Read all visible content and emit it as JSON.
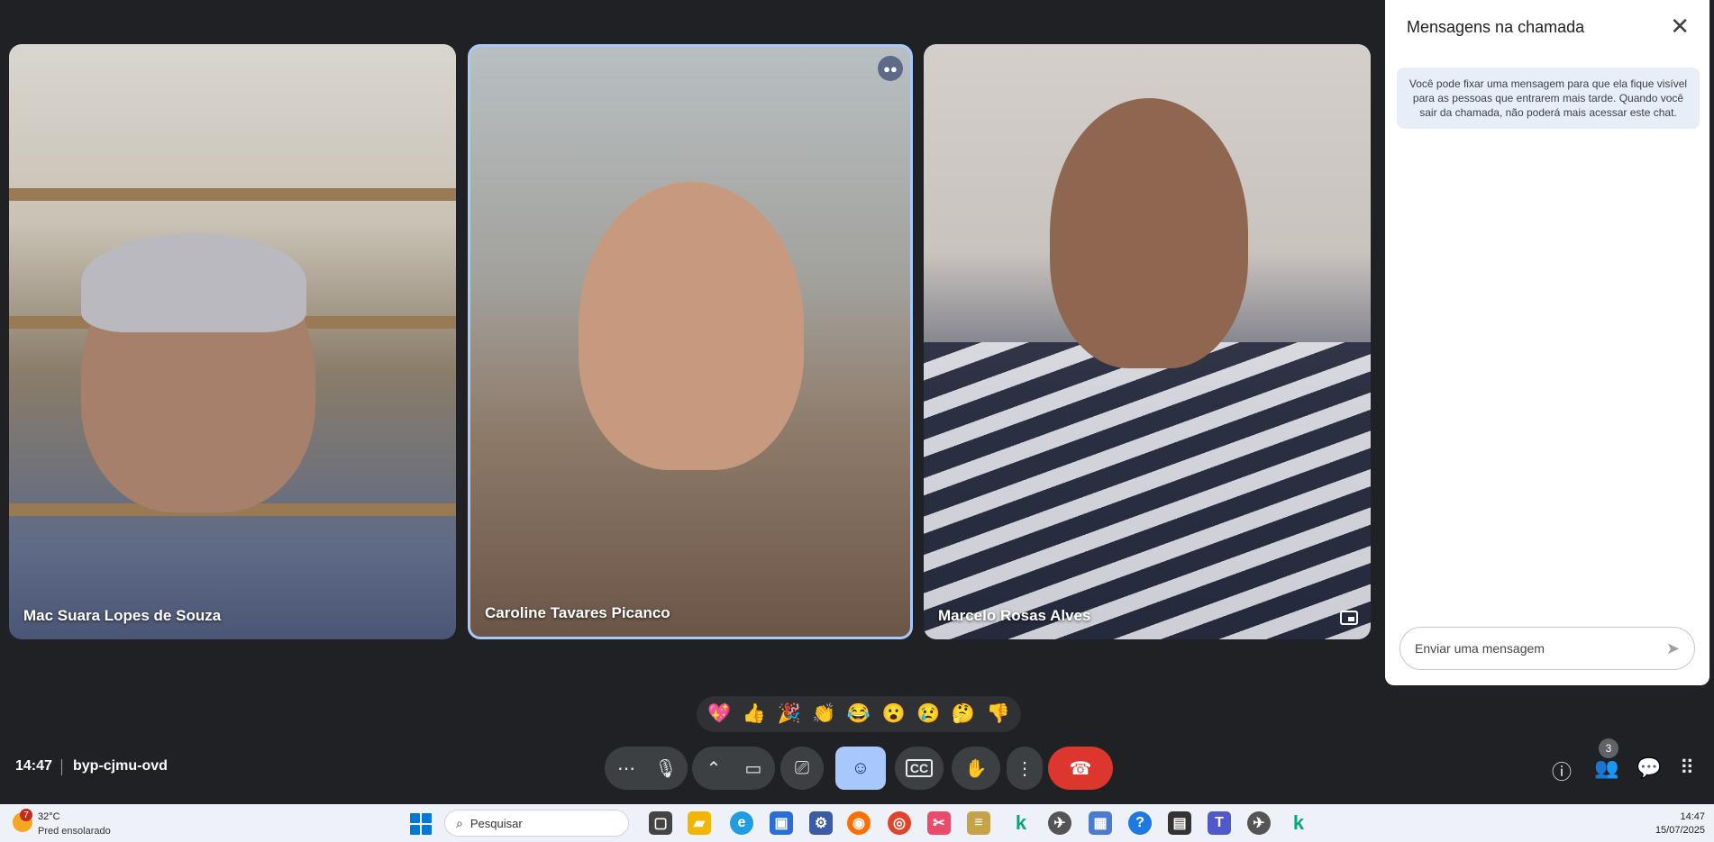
{
  "participants": [
    {
      "name": "Mac Suara Lopes de Souza"
    },
    {
      "name": "Caroline Tavares Picanco"
    },
    {
      "name": "Marcelo Rosas Alves"
    }
  ],
  "chat": {
    "title": "Mensagens na chamada",
    "note": "Você pode fixar uma mensagem para que ela fique visível para as pessoas que entrarem mais tarde. Quando você sair da chamada, não poderá mais acessar este chat.",
    "input_placeholder": "Enviar uma mensagem"
  },
  "reactions": [
    "💖",
    "👍",
    "🎉",
    "👏",
    "😂",
    "😮",
    "😢",
    "🤔",
    "👎"
  ],
  "meeting": {
    "time": "14:47",
    "code": "byp-cjmu-ovd",
    "people_count": "3"
  },
  "taskbar": {
    "weather_alert_count": "7",
    "temperature": "32°C",
    "weather": "Pred ensolarado",
    "search_placeholder": "Pesquisar",
    "clock_time": "14:47",
    "clock_date": "15/07/2025"
  },
  "colors": {
    "background": "#202124",
    "active_speaker_border": "#a8c7fa",
    "end_call": "#dc362e",
    "chat_note_bg": "#e8eef8"
  }
}
